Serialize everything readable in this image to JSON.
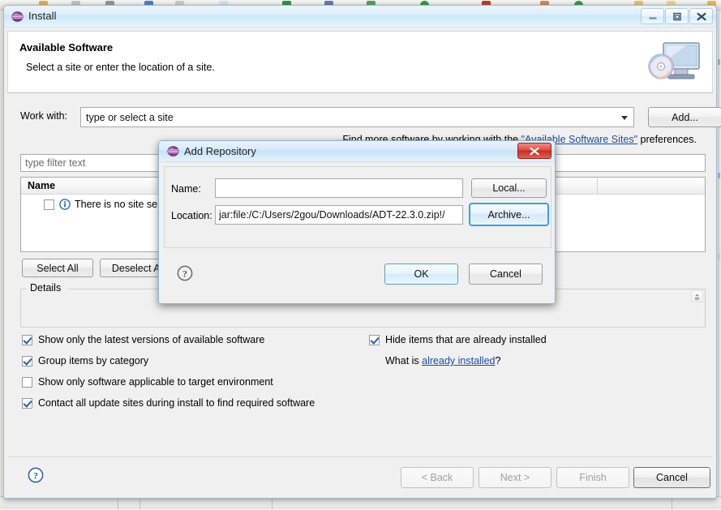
{
  "window": {
    "title": "Install",
    "icon": "eclipse-sphere-icon",
    "controls": [
      {
        "name": "minimize",
        "glyph": "—"
      },
      {
        "name": "maximize",
        "glyph": "□"
      },
      {
        "name": "close",
        "glyph": "✕"
      }
    ]
  },
  "banner": {
    "title": "Available Software",
    "subtitle": "Select a site or enter the location of a site.",
    "icon": "monitor-disc-icon"
  },
  "work_with": {
    "label": "Work with:",
    "value": "",
    "placeholder": "type or select a site",
    "dropdown_icon": "chevron-down-icon",
    "add_button": "Add..."
  },
  "find_more": {
    "prefix": "Find more software by working with the ",
    "link": "\"Available Software Sites\"",
    "suffix": " preferences."
  },
  "filter": {
    "value": "",
    "placeholder": "type filter text"
  },
  "tree": {
    "columns": [
      "Name",
      "",
      ""
    ],
    "rows": [
      {
        "checked": false,
        "icon": "info-icon",
        "label": "There is no site selected."
      }
    ]
  },
  "selection_buttons": {
    "select_all": "Select All",
    "deselect_all": "Deselect All"
  },
  "details": {
    "legend": "Details",
    "body": "",
    "scroll_icon": "scroll-up-icon"
  },
  "options": {
    "left": [
      {
        "label": "Show only the latest versions of available software",
        "checked": true
      },
      {
        "label": "Group items by category",
        "checked": true
      },
      {
        "label": "Show only software applicable to target environment",
        "checked": false
      },
      {
        "label": "Contact all update sites during install to find required software",
        "checked": true
      }
    ],
    "right": [
      {
        "label": "Hide items that are already installed",
        "checked": true
      }
    ],
    "what_is": {
      "prefix": "What is ",
      "link": "already installed",
      "suffix": "?"
    }
  },
  "footer": {
    "help_icon": "help-question-icon",
    "buttons": [
      {
        "label": "< Back",
        "enabled": false
      },
      {
        "label": "Next >",
        "enabled": false
      },
      {
        "label": "Finish",
        "enabled": false
      },
      {
        "label": "Cancel",
        "enabled": true
      }
    ]
  },
  "add_repository": {
    "title": "Add Repository",
    "icon": "eclipse-sphere-icon",
    "close_glyph": "✕",
    "name_label": "Name:",
    "name_value": "",
    "local_button": "Local...",
    "location_label": "Location:",
    "location_value": "jar:file:/C:/Users/2gou/Downloads/ADT-22.3.0.zip!/",
    "archive_button": "Archive...",
    "help_icon": "help-question-icon",
    "ok_button": "OK",
    "cancel_button": "Cancel"
  },
  "colors": {
    "title_bar": "#d6eafa",
    "link": "#1a4fa0",
    "focus_ring": "#3c9fe0",
    "close_red": "#c32b20",
    "window_bg": "#f0f0f0"
  }
}
